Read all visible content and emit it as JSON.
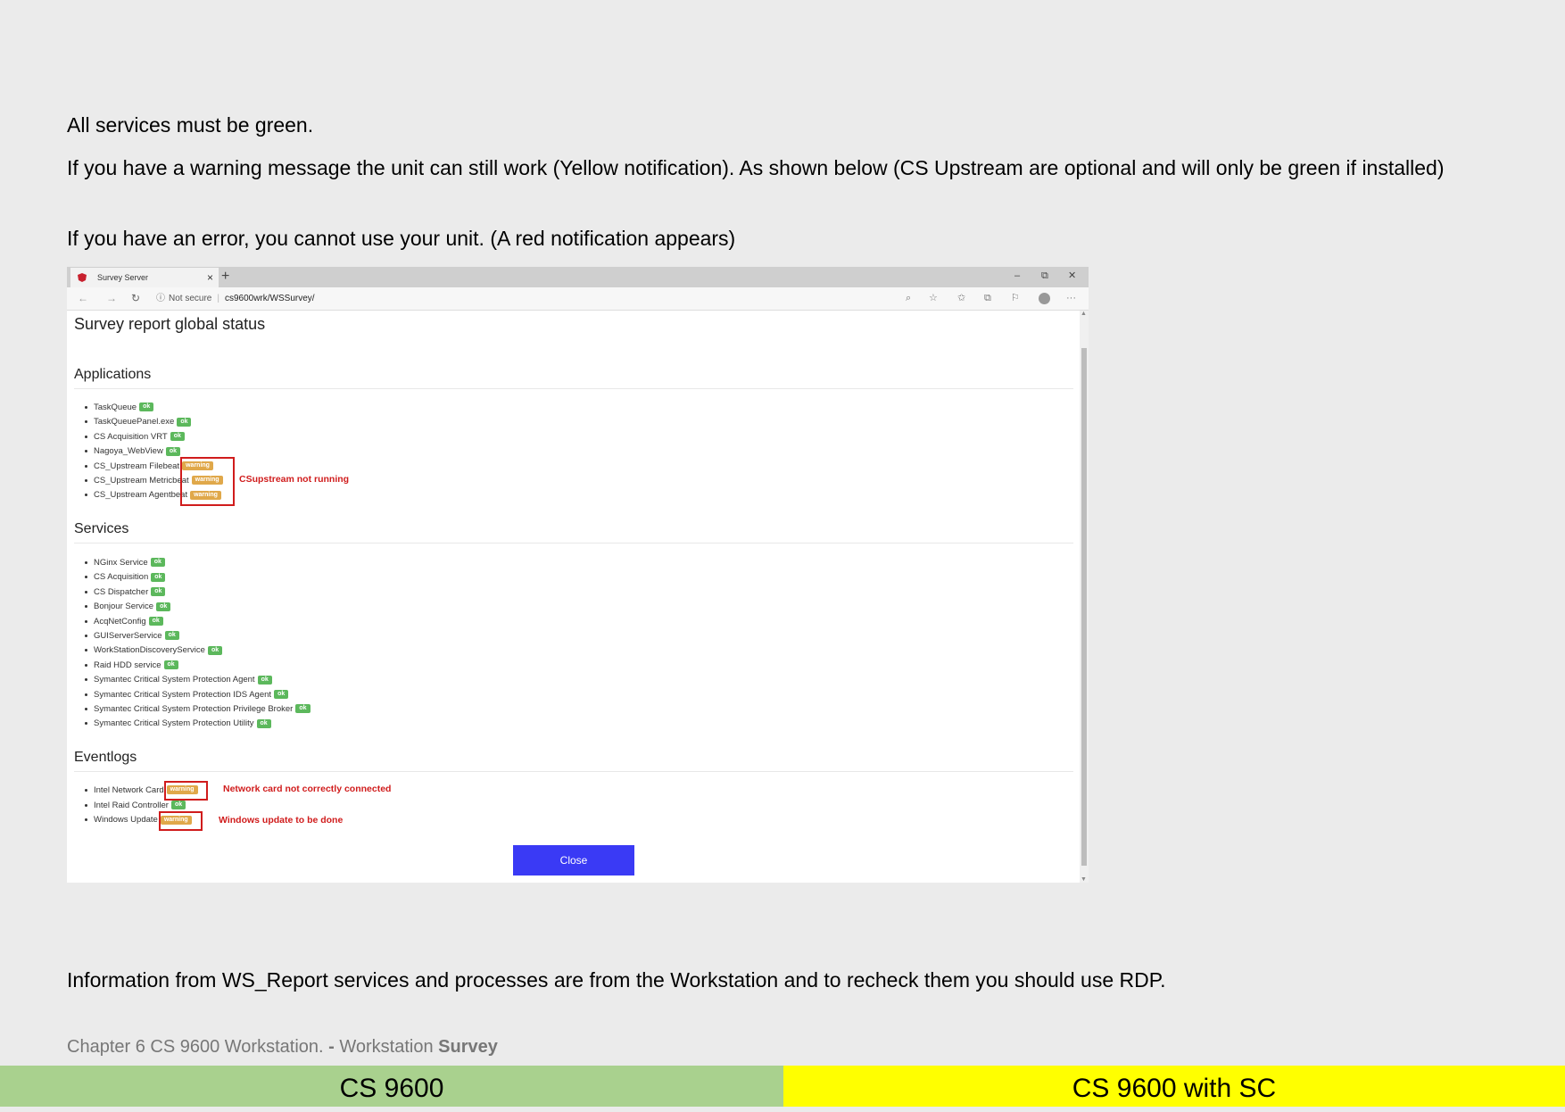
{
  "paragraphs": {
    "p1": "All services must be green.",
    "p2": "If you have a warning message the unit can still work (Yellow notification). As shown below (CS Upstream are optional and will only be green if installed)",
    "p3": "If you have an error, you cannot use your unit. (A red notification appears)",
    "p4": "Information from WS_Report services and processes are from the Workstation and to recheck them you should use RDP."
  },
  "browser": {
    "tab_title": "Survey Server",
    "tab_close": "×",
    "new_tab": "+",
    "minimize": "–",
    "restore": "⧉",
    "close": "✕",
    "not_secure": "Not secure",
    "url": "cs9600wrk/WSSurvey/",
    "more": "···"
  },
  "report": {
    "title": "Survey report global status",
    "applications_heading": "Applications",
    "applications": [
      {
        "name": "TaskQueue",
        "status": "ok"
      },
      {
        "name": "TaskQueuePanel.exe",
        "status": "ok"
      },
      {
        "name": "CS Acquisition VRT",
        "status": "ok"
      },
      {
        "name": "Nagoya_WebView",
        "status": "ok"
      },
      {
        "name": "CS_Upstream Filebeat",
        "status": "warning"
      },
      {
        "name": "CS_Upstream Metricbeat",
        "status": "warning"
      },
      {
        "name": "CS_Upstream Agentbeat",
        "status": "warning"
      }
    ],
    "services_heading": "Services",
    "services": [
      {
        "name": "NGinx Service",
        "status": "ok"
      },
      {
        "name": "CS Acquisition",
        "status": "ok"
      },
      {
        "name": "CS Dispatcher",
        "status": "ok"
      },
      {
        "name": "Bonjour Service",
        "status": "ok"
      },
      {
        "name": "AcqNetConfig",
        "status": "ok"
      },
      {
        "name": "GUIServerService",
        "status": "ok"
      },
      {
        "name": "WorkStationDiscoveryService",
        "status": "ok"
      },
      {
        "name": "Raid HDD service",
        "status": "ok"
      },
      {
        "name": "Symantec Critical System Protection Agent",
        "status": "ok"
      },
      {
        "name": "Symantec Critical System Protection IDS Agent",
        "status": "ok"
      },
      {
        "name": "Symantec Critical System Protection Privilege Broker",
        "status": "ok"
      },
      {
        "name": "Symantec Critical System Protection Utility",
        "status": "ok"
      }
    ],
    "eventlogs_heading": "Eventlogs",
    "eventlogs": [
      {
        "name": "Intel Network Card",
        "status": "warning"
      },
      {
        "name": "Intel Raid Controller",
        "status": "ok"
      },
      {
        "name": "Windows Update",
        "status": "warning"
      }
    ],
    "close_label": "Close"
  },
  "annotations": {
    "upstream": "CSupstream not running",
    "network": "Network card not correctly connected",
    "windows": "Windows update to be done"
  },
  "footer": {
    "chapter": "Chapter 6 CS 9600 Workstation.",
    "dash": "-",
    "section": "Workstation",
    "section_bold": "Survey",
    "band_left": "CS 9600",
    "band_right": "CS 9600 with SC"
  },
  "colors": {
    "ok": "#5cb85c",
    "warning": "#e0a84a",
    "annotation": "#d01c1c",
    "button": "#3a3af5",
    "band_left": "#a9d18e",
    "band_right": "#ffff00"
  }
}
